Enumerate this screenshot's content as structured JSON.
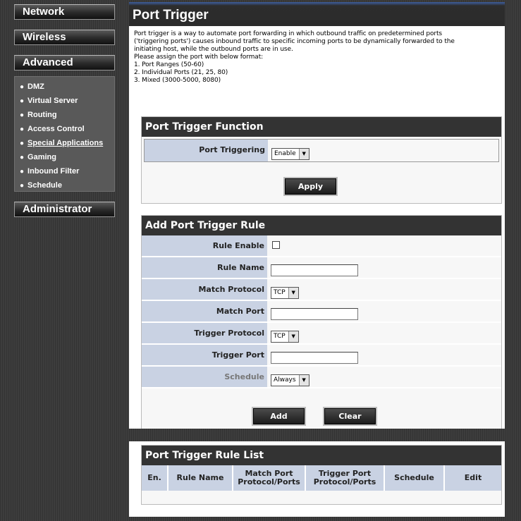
{
  "sidebar": {
    "network": "Network",
    "wireless": "Wireless",
    "advanced": "Advanced",
    "administrator": "Administrator",
    "items": [
      {
        "label": "DMZ"
      },
      {
        "label": "Virtual Server"
      },
      {
        "label": "Routing"
      },
      {
        "label": "Access Control"
      },
      {
        "label": "Special Applications"
      },
      {
        "label": "Gaming"
      },
      {
        "label": "Inbound Filter"
      },
      {
        "label": "Schedule"
      }
    ]
  },
  "page": {
    "title": "Port Trigger",
    "description": [
      "Port trigger is a way to automate port forwarding in which outbound traffic on predetermined ports",
      "('triggering ports') causes inbound traffic to specific incoming ports to be dynamically forwarded to the",
      "initiating host, while the outbound ports are in use.",
      "Please assign the port with below format:",
      "1. Port Ranges (50-60)",
      "2. Individual Ports (21, 25, 80)",
      "3. Mixed (3000-5000, 8080)"
    ]
  },
  "function_section": {
    "title": "Port Trigger Function",
    "port_triggering_label": "Port Triggering",
    "port_triggering_value": "Enable",
    "apply_label": "Apply"
  },
  "add_rule": {
    "title": "Add Port Trigger Rule",
    "rule_enable_label": "Rule Enable",
    "rule_name_label": "Rule Name",
    "rule_name_value": "",
    "match_protocol_label": "Match Protocol",
    "match_protocol_value": "TCP",
    "match_port_label": "Match Port",
    "match_port_value": "",
    "trigger_protocol_label": "Trigger Protocol",
    "trigger_protocol_value": "TCP",
    "trigger_port_label": "Trigger Port",
    "trigger_port_value": "",
    "schedule_label": "Schedule",
    "schedule_value": "Always",
    "add_label": "Add",
    "clear_label": "Clear"
  },
  "rule_list": {
    "title": "Port Trigger Rule List",
    "columns": {
      "en": "En.",
      "rule_name": "Rule Name",
      "match_port_1": "Match Port",
      "match_port_2": "Protocol/Ports",
      "trigger_port_1": "Trigger Port",
      "trigger_port_2": "Protocol/Ports",
      "schedule": "Schedule",
      "edit": "Edit"
    }
  }
}
